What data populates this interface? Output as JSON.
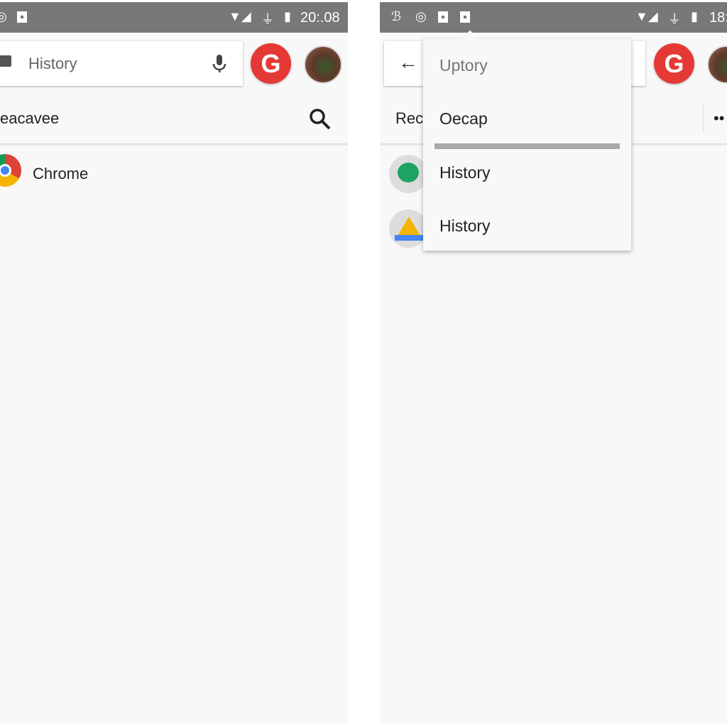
{
  "left": {
    "status": {
      "time": "20:.08"
    },
    "search": {
      "placeholder": "History"
    },
    "g_button": "G",
    "header": {
      "title": "eacavee"
    },
    "list": [
      {
        "label": "Chrome",
        "icon": "chrome-icon"
      }
    ]
  },
  "right": {
    "status": {
      "time": "18:"
    },
    "g_button": "G",
    "header": {
      "title": "Rec",
      "more": "••"
    },
    "list": [
      {
        "icon": "hangouts-icon"
      },
      {
        "icon": "drive-icon"
      }
    ],
    "menu": {
      "items": [
        "Uptory",
        "Oecap",
        "History",
        "History"
      ]
    }
  },
  "colors": {
    "status_bar": "#787878",
    "g_red": "#e53935",
    "background": "#f8f8f8"
  }
}
